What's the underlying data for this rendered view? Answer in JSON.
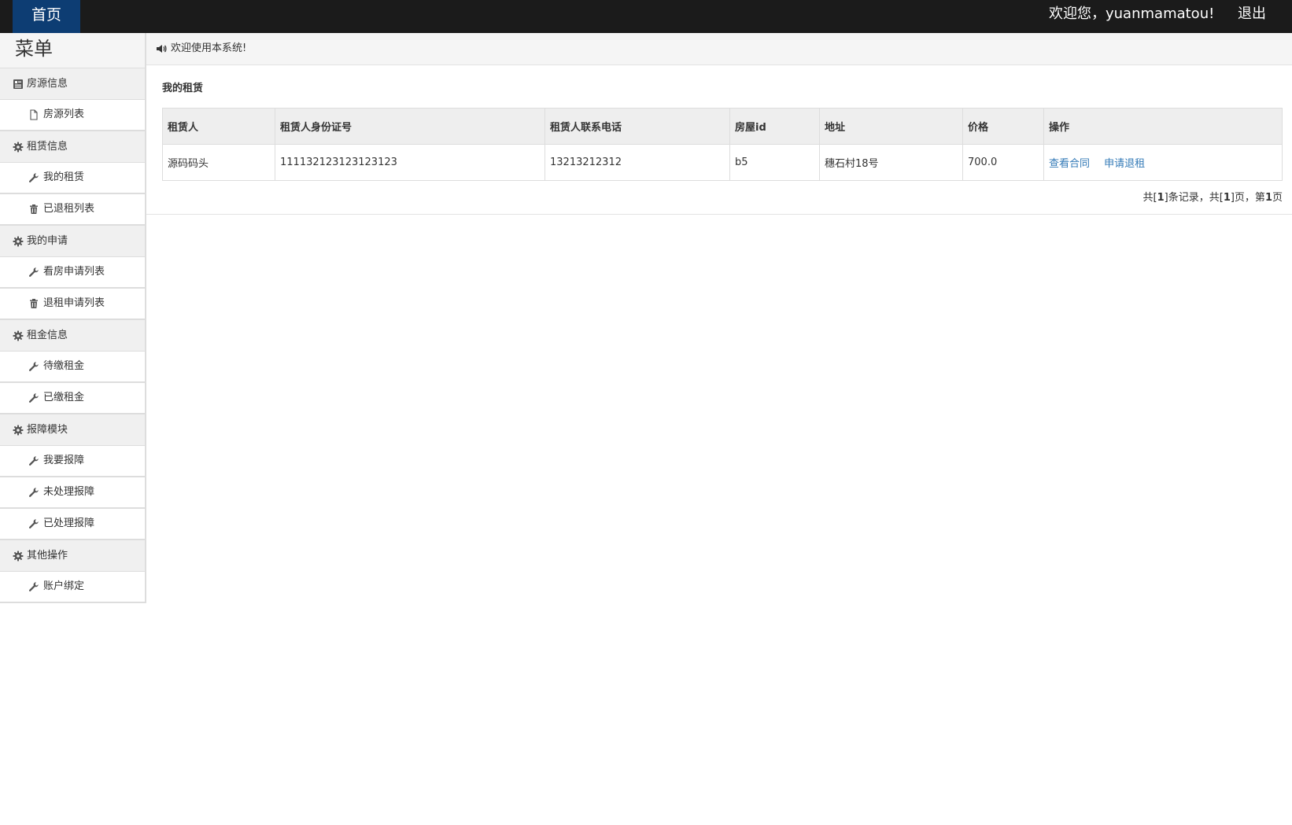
{
  "topbar": {
    "home_label": "首页",
    "welcome_text": "欢迎您，yuanmamatou!",
    "logout_label": "退出"
  },
  "sidebar": {
    "title": "菜单",
    "groups": [
      {
        "label": "房源信息",
        "icon": "list-icon",
        "items": [
          {
            "label": "房源列表",
            "icon": "file-icon"
          }
        ]
      },
      {
        "label": "租赁信息",
        "icon": "gear-icon",
        "items": [
          {
            "label": "我的租赁",
            "icon": "wrench-icon"
          },
          {
            "label": "已退租列表",
            "icon": "trash-icon"
          }
        ]
      },
      {
        "label": "我的申请",
        "icon": "gear-icon",
        "items": [
          {
            "label": "看房申请列表",
            "icon": "wrench-icon"
          },
          {
            "label": "退租申请列表",
            "icon": "trash-icon"
          }
        ]
      },
      {
        "label": "租金信息",
        "icon": "gear-icon",
        "items": [
          {
            "label": "待缴租金",
            "icon": "wrench-icon"
          },
          {
            "label": "已缴租金",
            "icon": "wrench-icon"
          }
        ]
      },
      {
        "label": "报障模块",
        "icon": "gear-icon",
        "items": [
          {
            "label": "我要报障",
            "icon": "wrench-icon"
          },
          {
            "label": "未处理报障",
            "icon": "wrench-icon"
          },
          {
            "label": "已处理报障",
            "icon": "wrench-icon"
          }
        ]
      },
      {
        "label": "其他操作",
        "icon": "gear-icon",
        "items": [
          {
            "label": "账户绑定",
            "icon": "wrench-icon"
          }
        ]
      }
    ]
  },
  "notice": {
    "icon": "volume-icon",
    "text": "欢迎使用本系统!"
  },
  "panel": {
    "title": "我的租赁",
    "table": {
      "headers": [
        "租赁人",
        "租赁人身份证号",
        "租赁人联系电话",
        "房屋id",
        "地址",
        "价格",
        "操作"
      ],
      "rows": [
        {
          "cells": [
            "源码码头",
            "111132123123123123",
            "13213212312",
            "b5",
            "穗石村18号",
            "700.0"
          ],
          "actions": [
            "查看合同",
            "申请退租"
          ]
        }
      ]
    },
    "pager": {
      "prefix": "共[",
      "records": "1",
      "mid1": "]条记录，共[",
      "pages": "1",
      "mid2": "]页，第",
      "current": "1",
      "suffix": "页"
    }
  },
  "colors": {
    "topbar_bg": "#1b1b1b",
    "home_bg": "#0d3d73",
    "link": "#337ab7",
    "group_bg": "#f0f0f0",
    "border": "#dddddd"
  }
}
